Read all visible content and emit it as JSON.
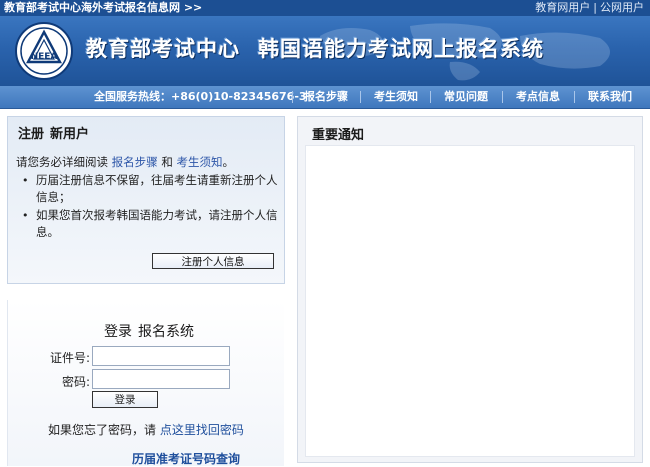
{
  "topbar": {
    "site_link": "教育部考试中心海外考试报名信息网 >>",
    "user_links": [
      "教育网用户",
      "公网用户"
    ]
  },
  "banner": {
    "logo_text": "NEEA",
    "org_name": "教育部考试中心",
    "system_name": "韩国语能力考试网上报名系统"
  },
  "nav": {
    "hotline": "全国服务热线：+86(0)10-82345676-3",
    "items": [
      "报名步骤",
      "考生须知",
      "常见问题",
      "考点信息",
      "联系我们"
    ]
  },
  "register": {
    "title_1": "注册",
    "title_2": "新用户",
    "intro_prefix": "请您务必详细阅读",
    "link_steps": "报名步骤",
    "intro_and": "和",
    "link_notice": "考生须知",
    "intro_suffix": "。",
    "tips": [
      "历届注册信息不保留，往届考生请重新注册个人信息；",
      "如果您首次报考韩国语能力考试，请注册个人信息。"
    ],
    "button": "注册个人信息"
  },
  "login": {
    "title_1": "登录",
    "title_2": "报名系统",
    "id_label": "证件号:",
    "id_value": "",
    "pwd_label": "密码:",
    "pwd_value": "",
    "button": "登录",
    "forgot_prefix": "如果您忘了密码，请",
    "forgot_link": "点这里找回密码",
    "history_link": "历届准考证号码查询"
  },
  "notice": {
    "title": "重要通知"
  },
  "colors": {
    "topbar": "#1c4f93",
    "banner": "#2a63ad",
    "link": "#2d56a8"
  }
}
